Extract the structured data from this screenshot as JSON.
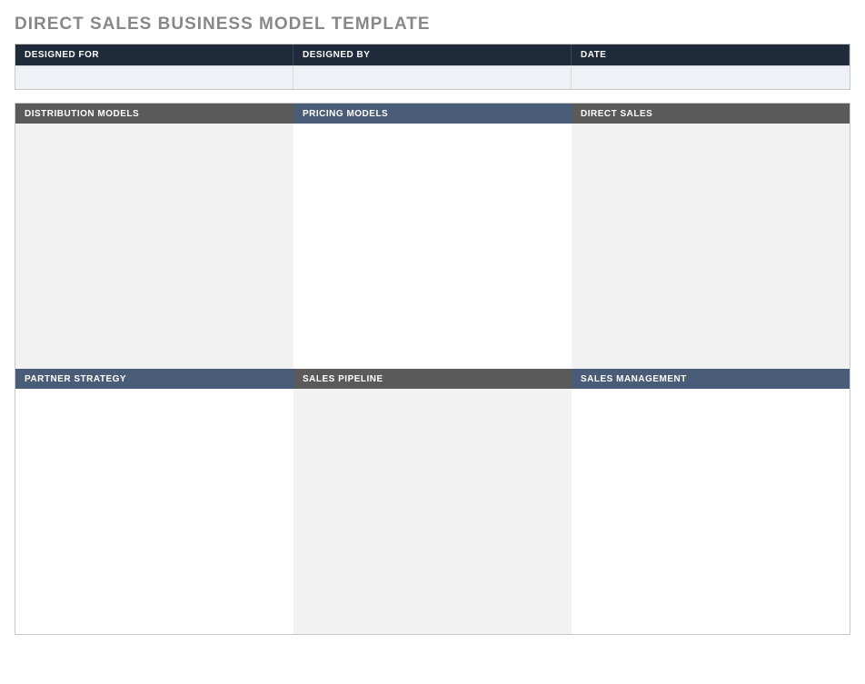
{
  "title": "DIRECT SALES BUSINESS MODEL TEMPLATE",
  "meta": {
    "designed_for_label": "DESIGNED FOR",
    "designed_for_value": "",
    "designed_by_label": "DESIGNED BY",
    "designed_by_value": "",
    "date_label": "DATE",
    "date_value": ""
  },
  "sections": {
    "row1": {
      "col1": {
        "label": "DISTRIBUTION MODELS",
        "value": ""
      },
      "col2": {
        "label": "PRICING MODELS",
        "value": ""
      },
      "col3": {
        "label": "DIRECT SALES",
        "value": ""
      }
    },
    "row2": {
      "col1": {
        "label": "PARTNER STRATEGY",
        "value": ""
      },
      "col2": {
        "label": "SALES PIPELINE",
        "value": ""
      },
      "col3": {
        "label": "SALES MANAGEMENT",
        "value": ""
      }
    }
  }
}
